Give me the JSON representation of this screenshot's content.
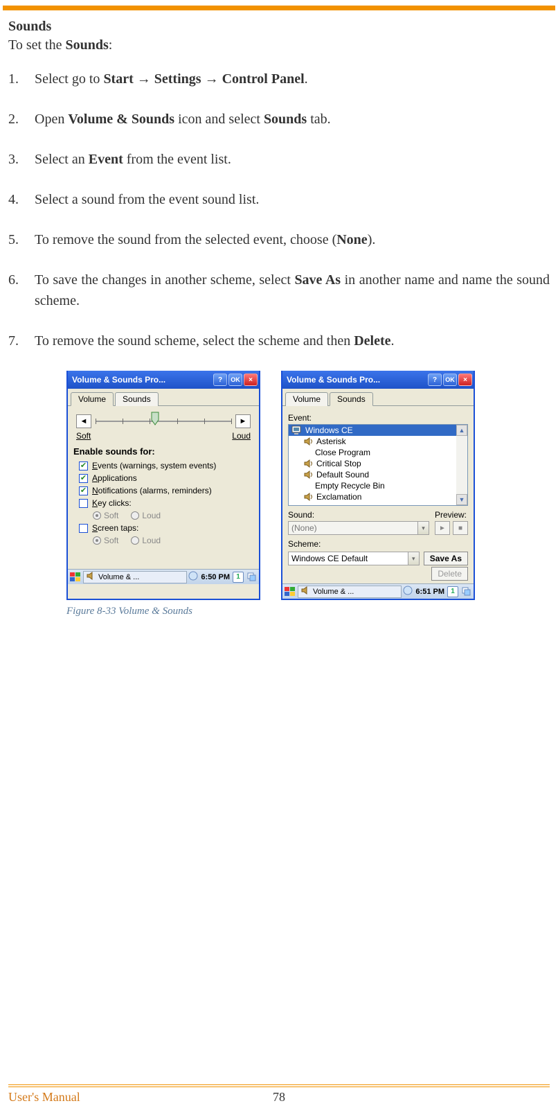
{
  "heading": "Sounds",
  "intro_prefix": "To set the ",
  "intro_bold": "Sounds",
  "intro_suffix": ":",
  "steps": [
    {
      "pre": "Select go to ",
      "b1": "Start",
      "mid1": " → ",
      "b2": "Settings",
      "mid2": " → ",
      "b3": "Control Panel",
      "post": "."
    },
    {
      "pre": "Open ",
      "b1": "Volume & Sounds",
      "mid1": " icon and select ",
      "b2": "Sounds",
      "post": " tab."
    },
    {
      "pre": "Select an ",
      "b1": "Event",
      "post": " from the event list."
    },
    {
      "pre": "Select a sound from the event sound list."
    },
    {
      "pre": "To remove the sound from the selected event, choose (",
      "b1": "None",
      "post": ")."
    },
    {
      "pre": "To save the changes in another scheme, select ",
      "b1": "Save As",
      "post": " in another name and name the sound scheme."
    },
    {
      "pre": "To remove the sound scheme, select the scheme and then ",
      "b1": "Delete",
      "post": "."
    }
  ],
  "figure_caption": "Figure 8-33 Volume & Sounds",
  "left_window": {
    "title": "Volume & Sounds Pro...",
    "help": "?",
    "ok": "OK",
    "close": "×",
    "tabs": {
      "volume": "Volume",
      "sounds": "Sounds",
      "active": "volume"
    },
    "soft": "Soft",
    "loud": "Loud",
    "section": "Enable sounds for:",
    "opts": {
      "events": {
        "label": "Events (warnings, system events)",
        "u": "E",
        "checked": true
      },
      "apps": {
        "label": "Applications",
        "u": "A",
        "checked": true
      },
      "notif": {
        "label": "Notifications (alarms, reminders)",
        "u": "N",
        "checked": true
      },
      "key": {
        "label": "Key clicks:",
        "u": "K",
        "checked": false,
        "soft": "Soft",
        "loud": "Loud",
        "sel": "soft"
      },
      "screen": {
        "label": "Screen taps:",
        "u": "S",
        "checked": false,
        "soft": "Soft",
        "loud": "Loud",
        "sel": "soft"
      }
    },
    "taskbar": {
      "task": "Volume & ...",
      "time": "6:50 PM",
      "badge": "1"
    }
  },
  "right_window": {
    "title": "Volume & Sounds Pro...",
    "help": "?",
    "ok": "OK",
    "close": "×",
    "tabs": {
      "volume": "Volume",
      "sounds": "Sounds",
      "active": "sounds"
    },
    "event_label": "Event:",
    "events": [
      {
        "name": "Windows CE",
        "icon": "pc",
        "selected": true
      },
      {
        "name": "Asterisk",
        "icon": "spk"
      },
      {
        "name": "Close Program",
        "icon": "none"
      },
      {
        "name": "Critical Stop",
        "icon": "spk"
      },
      {
        "name": "Default Sound",
        "icon": "spk"
      },
      {
        "name": "Empty Recycle Bin",
        "icon": "none"
      },
      {
        "name": "Exclamation",
        "icon": "spk"
      }
    ],
    "sound_label": "Sound:",
    "sound_value": "(None)",
    "preview_label": "Preview:",
    "scheme_label": "Scheme:",
    "scheme_value": "Windows CE Default",
    "saveas": "Save As",
    "delete": "Delete",
    "taskbar": {
      "task": "Volume & ...",
      "time": "6:51 PM",
      "badge": "1"
    }
  },
  "footer": {
    "left": "User's Manual",
    "page": "78"
  }
}
